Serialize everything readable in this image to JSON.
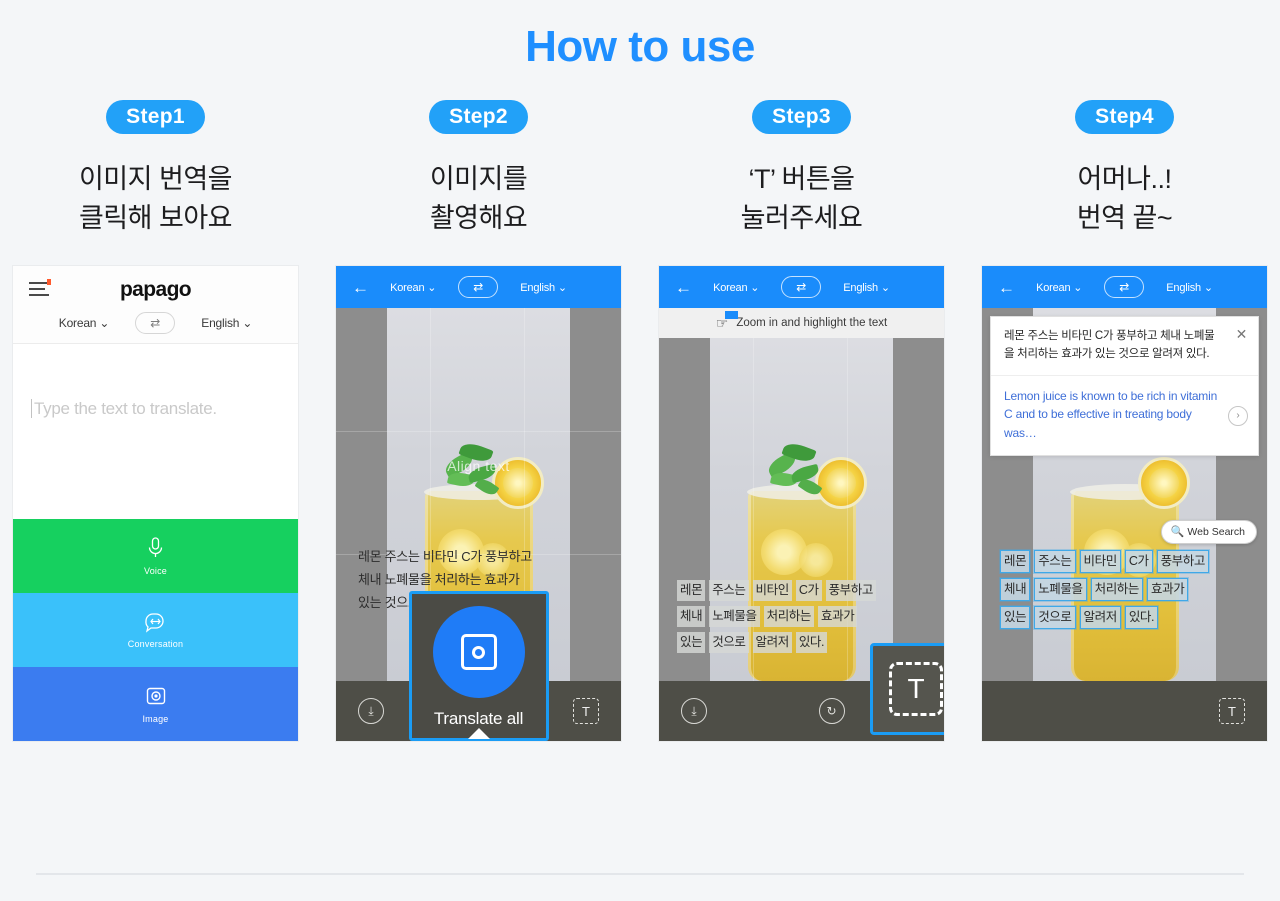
{
  "page": {
    "title": "How to use",
    "accent_blue": "#1f8fff",
    "background": "#f4f6f8"
  },
  "steps": [
    {
      "badge": "Step1",
      "caption": "이미지 번역을\n클릭해 보아요"
    },
    {
      "badge": "Step2",
      "caption": "이미지를\n촬영해요"
    },
    {
      "badge": "Step3",
      "caption": "‘T’ 버튼을\n눌러주세요"
    },
    {
      "badge": "Step4",
      "caption": "어머나..!\n번역 끝~"
    }
  ],
  "phone1": {
    "logo": "papago",
    "menu_icon": "hamburger-icon",
    "source_lang": "Korean",
    "target_lang": "English",
    "chevron": "⌄",
    "swap_icon": "⇄",
    "input_placeholder": "Type the text to translate.",
    "bands": [
      {
        "label": "Voice",
        "icon": "microphone-icon",
        "color": "#16d05f"
      },
      {
        "label": "Conversation",
        "icon": "conversation-icon",
        "color": "#3ac1fa"
      },
      {
        "label": "Image",
        "icon": "camera-icon",
        "color": "#3b7cf0"
      }
    ]
  },
  "phone2": {
    "back_icon": "←",
    "source_lang": "Korean",
    "target_lang": "English",
    "swap_icon": "⇄",
    "chevron": "⌄",
    "align_hint": "Align text",
    "korean_text": "레몬 주스는 비타민 C가 풍부하고\n체내 노폐물을 처리하는 효과가\n있는 것으로 알려져 있다.",
    "toolbar": {
      "save_icon": "⤓",
      "text_icon": "T"
    },
    "callout": {
      "label": "Translate all",
      "shutter_icon": "camera-shutter-icon",
      "border_color": "#1a9cf5"
    }
  },
  "phone3": {
    "back_icon": "←",
    "source_lang": "Korean",
    "target_lang": "English",
    "swap_icon": "⇄",
    "chevron": "⌄",
    "tip": "Zoom in and highlight the text",
    "tip_icon": "hand-pointer-icon",
    "korean_words": [
      [
        "레몬",
        "주스는",
        "비타인",
        "C가",
        "풍부하고"
      ],
      [
        "체내",
        "노폐물을",
        "처리하는",
        "효과가"
      ],
      [
        "있는",
        "것으로",
        "알려저",
        "있다."
      ]
    ],
    "toolbar": {
      "save_icon": "⤓",
      "rotate_icon": "↻"
    },
    "callout": {
      "label": "T",
      "border_color": "#1a9cf5"
    }
  },
  "phone4": {
    "back_icon": "←",
    "source_lang": "Korean",
    "target_lang": "English",
    "swap_icon": "⇄",
    "chevron": "⌄",
    "result": {
      "source_text": "레몬 주스는 비타민 C가 풍부하고 체내 노폐물을 처리하는 효과가 있는 것으로 알려져 있다.",
      "target_text": "Lemon juice is known to be rich in vitamin C and to be effective in treating body was…",
      "close_icon": "✕",
      "next_icon": "›"
    },
    "web_search": {
      "label": "Web Search",
      "icon": "search-icon"
    },
    "korean_words": [
      [
        "레몬",
        "주스는",
        "비타민",
        "C가",
        "풍부하고"
      ],
      [
        "체내",
        "노폐물을",
        "처리하는",
        "효과가"
      ],
      [
        "있는",
        "것으로",
        "알려저",
        "있다."
      ]
    ],
    "toolbar": {
      "text_icon": "T"
    }
  }
}
